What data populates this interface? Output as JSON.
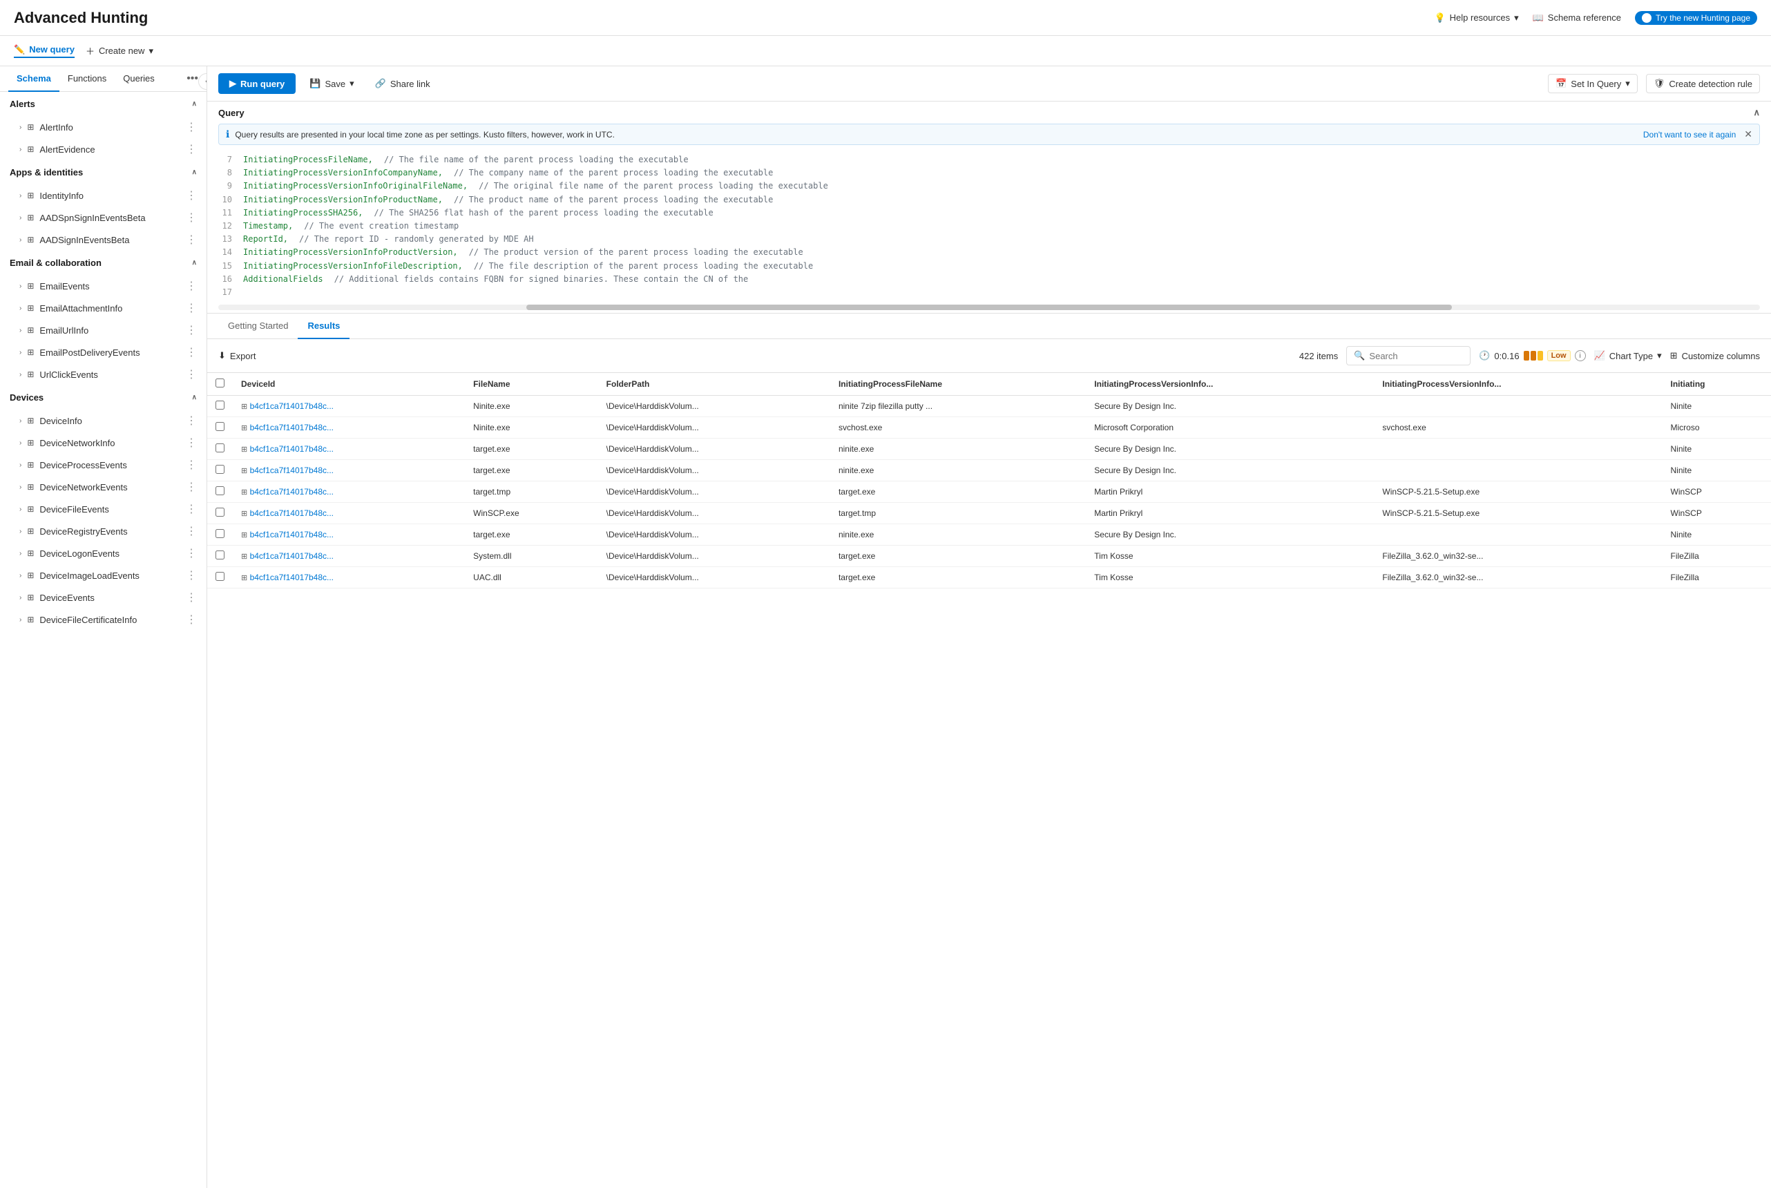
{
  "page": {
    "title": "Advanced Hunting"
  },
  "topbar": {
    "help_label": "Help resources",
    "schema_label": "Schema reference",
    "try_new_label": "Try the new Hunting page"
  },
  "subbar": {
    "new_query_label": "New query",
    "create_new_label": "Create new"
  },
  "sidebar": {
    "tabs": [
      {
        "id": "schema",
        "label": "Schema"
      },
      {
        "id": "functions",
        "label": "Functions"
      },
      {
        "id": "queries",
        "label": "Queries"
      }
    ],
    "sections": [
      {
        "id": "alerts",
        "label": "Alerts",
        "expanded": true,
        "items": [
          {
            "id": "alertinfo",
            "label": "AlertInfo"
          },
          {
            "id": "alertevidence",
            "label": "AlertEvidence"
          }
        ]
      },
      {
        "id": "apps-identities",
        "label": "Apps & identities",
        "expanded": true,
        "items": [
          {
            "id": "identityinfo",
            "label": "IdentityInfo"
          },
          {
            "id": "aadspnsigninevents",
            "label": "AADSpnSignInEventsBeta"
          },
          {
            "id": "aadsigninevents",
            "label": "AADSignInEventsBeta"
          }
        ]
      },
      {
        "id": "email-collab",
        "label": "Email & collaboration",
        "expanded": true,
        "items": [
          {
            "id": "emailevents",
            "label": "EmailEvents"
          },
          {
            "id": "emailattachmentinfo",
            "label": "EmailAttachmentInfo"
          },
          {
            "id": "emailurlinfo",
            "label": "EmailUrlInfo"
          },
          {
            "id": "emailpostdelivery",
            "label": "EmailPostDeliveryEvents"
          },
          {
            "id": "urlclickevents",
            "label": "UrlClickEvents"
          }
        ]
      },
      {
        "id": "devices",
        "label": "Devices",
        "expanded": true,
        "items": [
          {
            "id": "deviceinfo",
            "label": "DeviceInfo"
          },
          {
            "id": "devicenetworkinfo",
            "label": "DeviceNetworkInfo"
          },
          {
            "id": "deviceprocessevents",
            "label": "DeviceProcessEvents"
          },
          {
            "id": "devicenetworkevents",
            "label": "DeviceNetworkEvents"
          },
          {
            "id": "devicefileevents",
            "label": "DeviceFileEvents"
          },
          {
            "id": "deviceregistryevents",
            "label": "DeviceRegistryEvents"
          },
          {
            "id": "devicelogonevents",
            "label": "DeviceLogonEvents"
          },
          {
            "id": "deviceimageloadevents",
            "label": "DeviceImageLoadEvents"
          },
          {
            "id": "deviceevents",
            "label": "DeviceEvents"
          },
          {
            "id": "devicefilecertinfo",
            "label": "DeviceFileCertificateInfo"
          }
        ]
      }
    ]
  },
  "query": {
    "title": "Query",
    "info_text": "Query results are presented in your local time zone as per settings. Kusto filters, however, work in UTC.",
    "dont_show_label": "Don't want to see it again",
    "lines": [
      {
        "num": "7",
        "code": "InitiatingProcessFileName,",
        "comment": "// The file name of the parent process loading the executable"
      },
      {
        "num": "8",
        "code": "InitiatingProcessVersionInfoCompanyName,",
        "comment": "// The company name of the parent process loading the executable"
      },
      {
        "num": "9",
        "code": "InitiatingProcessVersionInfoOriginalFileName,",
        "comment": "// The original file name of the parent process loading the executable"
      },
      {
        "num": "10",
        "code": "InitiatingProcessVersionInfoProductName,",
        "comment": "// The product name of the parent process loading the executable"
      },
      {
        "num": "11",
        "code": "InitiatingProcessSHA256,",
        "comment": "// The SHA256 flat hash of the parent process loading the executable"
      },
      {
        "num": "12",
        "code": "Timestamp,",
        "comment": "// The event creation timestamp"
      },
      {
        "num": "13",
        "code": "ReportId,",
        "comment": "// The report ID - randomly generated by MDE AH"
      },
      {
        "num": "14",
        "code": "InitiatingProcessVersionInfoProductVersion,",
        "comment": "// The product version of the parent process loading the executable"
      },
      {
        "num": "15",
        "code": "InitiatingProcessVersionInfoFileDescription,",
        "comment": "// The file description of the parent process loading the executable"
      },
      {
        "num": "16",
        "code": "AdditionalFields",
        "comment": "// Additional fields contains FQBN for signed binaries.  These contain the CN of the"
      },
      {
        "num": "17",
        "code": "",
        "comment": ""
      }
    ],
    "toolbar": {
      "run_label": "Run query",
      "save_label": "Save",
      "share_label": "Share link",
      "set_in_query_label": "Set In Query",
      "create_detection_label": "Create detection rule"
    }
  },
  "results": {
    "tabs": [
      {
        "id": "getting-started",
        "label": "Getting Started"
      },
      {
        "id": "results",
        "label": "Results"
      }
    ],
    "export_label": "Export",
    "items_count": "422 items",
    "search_placeholder": "Search",
    "timing": "0:0.16",
    "low_label": "Low",
    "chart_type_label": "Chart Type",
    "customize_label": "Customize columns",
    "columns": [
      {
        "id": "deviceid",
        "label": "DeviceId"
      },
      {
        "id": "filename",
        "label": "FileName"
      },
      {
        "id": "folderpath",
        "label": "FolderPath"
      },
      {
        "id": "initiating-filename",
        "label": "InitiatingProcessFileName"
      },
      {
        "id": "initiating-versioninfo1",
        "label": "InitiatingProcessVersionInfo..."
      },
      {
        "id": "initiating-versioninfo2",
        "label": "InitiatingProcessVersionInfo..."
      },
      {
        "id": "initiating",
        "label": "Initiating"
      }
    ],
    "rows": [
      {
        "deviceid": "b4cf1ca7f14017b48c...",
        "filename": "Ninite.exe",
        "folderpath": "\\Device\\HarddiskVolum...",
        "initiating_filename": "ninite 7zip filezilla putty ...",
        "version_info1": "Secure By Design Inc.",
        "version_info2": "",
        "initiating": "Ninite"
      },
      {
        "deviceid": "b4cf1ca7f14017b48c...",
        "filename": "Ninite.exe",
        "folderpath": "\\Device\\HarddiskVolum...",
        "initiating_filename": "svchost.exe",
        "version_info1": "Microsoft Corporation",
        "version_info2": "svchost.exe",
        "initiating": "Microso"
      },
      {
        "deviceid": "b4cf1ca7f14017b48c...",
        "filename": "target.exe",
        "folderpath": "\\Device\\HarddiskVolum...",
        "initiating_filename": "ninite.exe",
        "version_info1": "Secure By Design Inc.",
        "version_info2": "",
        "initiating": "Ninite"
      },
      {
        "deviceid": "b4cf1ca7f14017b48c...",
        "filename": "target.exe",
        "folderpath": "\\Device\\HarddiskVolum...",
        "initiating_filename": "ninite.exe",
        "version_info1": "Secure By Design Inc.",
        "version_info2": "",
        "initiating": "Ninite"
      },
      {
        "deviceid": "b4cf1ca7f14017b48c...",
        "filename": "target.tmp",
        "folderpath": "\\Device\\HarddiskVolum...",
        "initiating_filename": "target.exe",
        "version_info1": "Martin Prikryl",
        "version_info2": "WinSCP-5.21.5-Setup.exe",
        "initiating": "WinSCP"
      },
      {
        "deviceid": "b4cf1ca7f14017b48c...",
        "filename": "WinSCP.exe",
        "folderpath": "\\Device\\HarddiskVolum...",
        "initiating_filename": "target.tmp",
        "version_info1": "Martin Prikryl",
        "version_info2": "WinSCP-5.21.5-Setup.exe",
        "initiating": "WinSCP"
      },
      {
        "deviceid": "b4cf1ca7f14017b48c...",
        "filename": "target.exe",
        "folderpath": "\\Device\\HarddiskVolum...",
        "initiating_filename": "ninite.exe",
        "version_info1": "Secure By Design Inc.",
        "version_info2": "",
        "initiating": "Ninite"
      },
      {
        "deviceid": "b4cf1ca7f14017b48c...",
        "filename": "System.dll",
        "folderpath": "\\Device\\HarddiskVolum...",
        "initiating_filename": "target.exe",
        "version_info1": "Tim Kosse",
        "version_info2": "FileZilla_3.62.0_win32-se...",
        "initiating": "FileZilla"
      },
      {
        "deviceid": "b4cf1ca7f14017b48c...",
        "filename": "UAC.dll",
        "folderpath": "\\Device\\HarddiskVolum...",
        "initiating_filename": "target.exe",
        "version_info1": "Tim Kosse",
        "version_info2": "FileZilla_3.62.0_win32-se...",
        "initiating": "FileZilla"
      }
    ]
  }
}
